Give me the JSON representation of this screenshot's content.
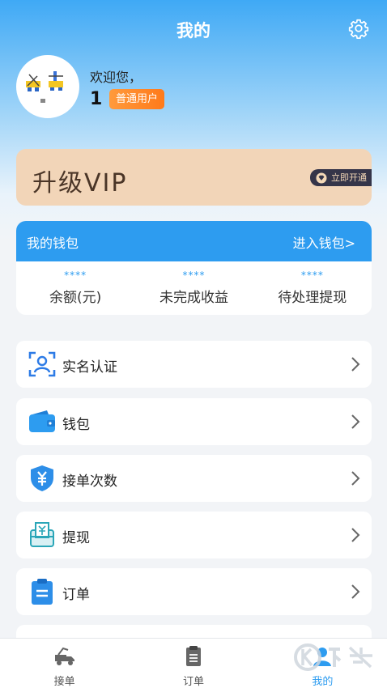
{
  "header": {
    "title": "我的"
  },
  "profile": {
    "welcome": "欢迎您，",
    "name": "1",
    "badge": "普通用户"
  },
  "vip": {
    "title": "升级VIP",
    "button": "立即开通"
  },
  "wallet": {
    "title": "我的钱包",
    "link": "进入钱包>",
    "stats": [
      {
        "value": "****",
        "label": "余额(元)"
      },
      {
        "value": "****",
        "label": "未完成收益"
      },
      {
        "value": "****",
        "label": "待处理提现"
      }
    ]
  },
  "menu": [
    {
      "label": "实名认证",
      "icon": "id-verify-icon"
    },
    {
      "label": "钱包",
      "icon": "wallet-icon"
    },
    {
      "label": "接单次数",
      "icon": "yen-shield-icon"
    },
    {
      "label": "提现",
      "icon": "withdraw-icon"
    },
    {
      "label": "订单",
      "icon": "order-clipboard-icon"
    }
  ],
  "tabs": [
    {
      "label": "接单",
      "icon": "tow-truck-icon"
    },
    {
      "label": "订单",
      "icon": "order-list-icon"
    },
    {
      "label": "我的",
      "icon": "user-icon"
    }
  ],
  "colors": {
    "accent": "#2d9cf0",
    "badge": "#ff8a2a",
    "vip_bg": "#f2d5b8",
    "vip_dark": "#353549"
  }
}
